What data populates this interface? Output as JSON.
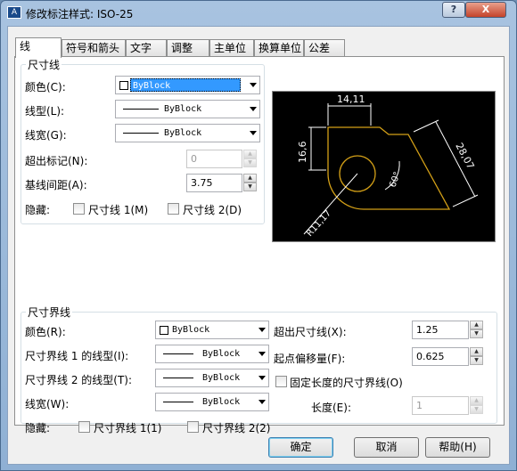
{
  "window": {
    "title": "修改标注样式: ISO-25",
    "help_button": "?",
    "close_button": "X"
  },
  "tabs": [
    "线",
    "符号和箭头",
    "文字",
    "调整",
    "主单位",
    "换算单位",
    "公差"
  ],
  "dim_line": {
    "group_title": "尺寸线",
    "color_label": "颜色(C):",
    "color_value": "ByBlock",
    "linetype_label": "线型(L):",
    "linetype_value": "ByBlock",
    "lineweight_label": "线宽(G):",
    "lineweight_value": "ByBlock",
    "extend_label": "超出标记(N):",
    "extend_value": "0",
    "baseline_label": "基线间距(A):",
    "baseline_value": "3.75",
    "suppress_label": "隐藏:",
    "suppress_1": "尺寸线 1(M)",
    "suppress_2": "尺寸线 2(D)"
  },
  "preview": {
    "dim_top": "14,11",
    "dim_left": "16,6",
    "dim_diag": "28,07",
    "dim_angle": "60°",
    "dim_radius": "R11,17"
  },
  "ext_line": {
    "group_title": "尺寸界线",
    "color_label": "颜色(R):",
    "color_value": "ByBlock",
    "linetype1_label": "尺寸界线 1 的线型(I):",
    "linetype1_value": "ByBlock",
    "linetype2_label": "尺寸界线 2 的线型(T):",
    "linetype2_value": "ByBlock",
    "lineweight_label": "线宽(W):",
    "lineweight_value": "ByBlock",
    "suppress_label": "隐藏:",
    "suppress_1": "尺寸界线 1(1)",
    "suppress_2": "尺寸界线 2(2)",
    "extend_label": "超出尺寸线(X):",
    "extend_value": "1.25",
    "offset_label": "起点偏移量(F):",
    "offset_value": "0.625",
    "fixed_label": "固定长度的尺寸界线(O)",
    "length_label": "长度(E):",
    "length_value": "1"
  },
  "buttons": {
    "ok": "确定",
    "cancel": "取消",
    "help": "帮助(H)"
  },
  "colors": {
    "preview_bg": "#000000",
    "geometry": "#d4a017",
    "dimension": "#ffffff",
    "selection": "#3399ff"
  }
}
